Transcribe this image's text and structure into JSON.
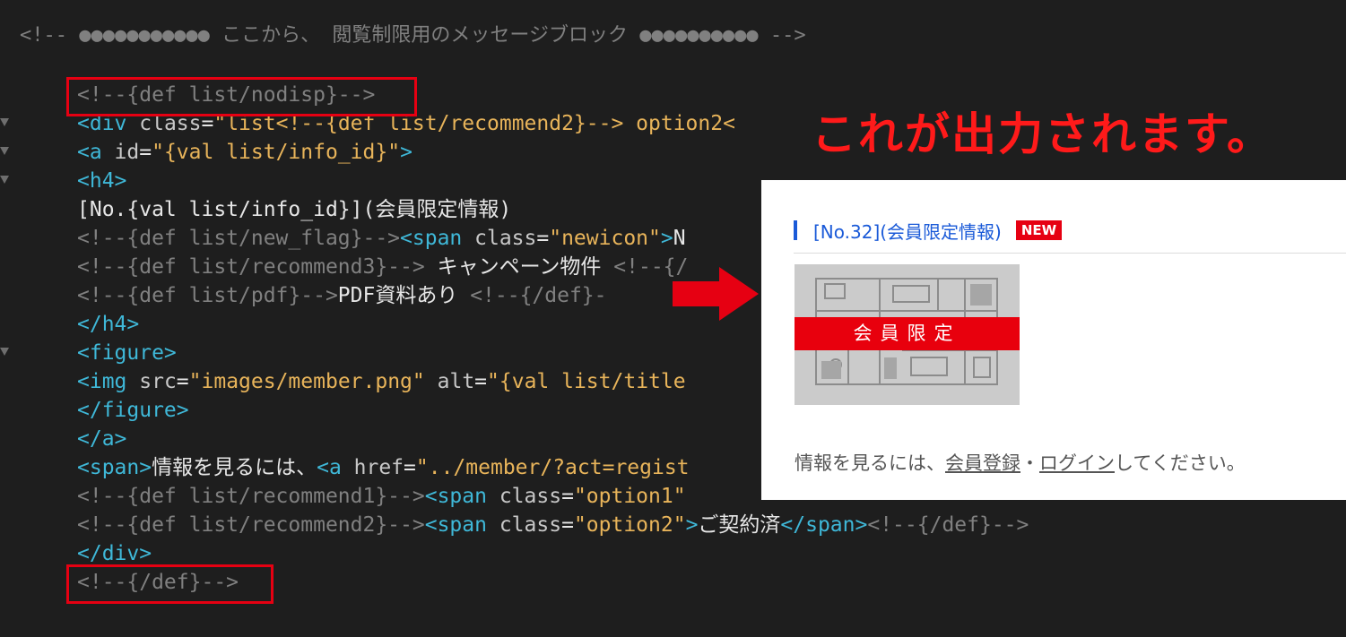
{
  "code_lines": [
    {
      "fold": false,
      "header": true,
      "tokens": [
        {
          "c": "c",
          "t": "<!-- ●●●●●●●●●●● ここから、 閲覧制限用のメッセージブロック ●●●●●●●●●● -->"
        }
      ]
    },
    {
      "fold": false,
      "tokens": [
        {
          "c": "c",
          "t": "<!--{def list/nodisp}-->"
        }
      ]
    },
    {
      "fold": true,
      "tokens": [
        {
          "c": "k",
          "t": "<div "
        },
        {
          "c": "a",
          "t": "class"
        },
        {
          "c": "w",
          "t": "="
        },
        {
          "c": "s",
          "t": "\"list<!--{def list/recommend2}--> option2<"
        }
      ]
    },
    {
      "fold": true,
      "tokens": [
        {
          "c": "k",
          "t": "<a "
        },
        {
          "c": "a",
          "t": "id"
        },
        {
          "c": "w",
          "t": "="
        },
        {
          "c": "s",
          "t": "\"{val list/info_id}\""
        },
        {
          "c": "k",
          "t": ">"
        }
      ]
    },
    {
      "fold": true,
      "tokens": [
        {
          "c": "k",
          "t": "<h4>"
        }
      ]
    },
    {
      "fold": false,
      "tokens": [
        {
          "c": "w",
          "t": "[No.{val list/info_id}](会員限定情報)"
        }
      ]
    },
    {
      "fold": false,
      "tokens": [
        {
          "c": "c",
          "t": "<!--{def list/new_flag}-->"
        },
        {
          "c": "k",
          "t": "<span "
        },
        {
          "c": "a",
          "t": "class"
        },
        {
          "c": "w",
          "t": "="
        },
        {
          "c": "s",
          "t": "\"newicon\""
        },
        {
          "c": "k",
          "t": ">"
        },
        {
          "c": "w",
          "t": "N"
        }
      ]
    },
    {
      "fold": false,
      "tokens": [
        {
          "c": "c",
          "t": "<!--{def list/recommend3}--> "
        },
        {
          "c": "w",
          "t": "キャンペーン物件 "
        },
        {
          "c": "c",
          "t": "<!--{/"
        }
      ]
    },
    {
      "fold": false,
      "tokens": [
        {
          "c": "c",
          "t": "<!--{def list/pdf}-->"
        },
        {
          "c": "w",
          "t": "PDF資料あり "
        },
        {
          "c": "c",
          "t": "<!--{/def}-"
        }
      ]
    },
    {
      "fold": false,
      "tokens": [
        {
          "c": "k",
          "t": "</h4>"
        }
      ]
    },
    {
      "fold": true,
      "tokens": [
        {
          "c": "k",
          "t": "<figure>"
        }
      ]
    },
    {
      "fold": false,
      "tokens": [
        {
          "c": "k",
          "t": "<img "
        },
        {
          "c": "a",
          "t": "src"
        },
        {
          "c": "w",
          "t": "="
        },
        {
          "c": "s",
          "t": "\"images/member.png\""
        },
        {
          "c": "w",
          "t": " "
        },
        {
          "c": "a",
          "t": "alt"
        },
        {
          "c": "w",
          "t": "="
        },
        {
          "c": "s",
          "t": "\"{val list/title"
        }
      ]
    },
    {
      "fold": false,
      "tokens": [
        {
          "c": "k",
          "t": "</figure>"
        }
      ]
    },
    {
      "fold": false,
      "tokens": [
        {
          "c": "k",
          "t": "</a>"
        }
      ]
    },
    {
      "fold": false,
      "tokens": [
        {
          "c": "k",
          "t": "<span>"
        },
        {
          "c": "w",
          "t": "情報を見るには、"
        },
        {
          "c": "k",
          "t": "<a "
        },
        {
          "c": "a",
          "t": "href"
        },
        {
          "c": "w",
          "t": "="
        },
        {
          "c": "s",
          "t": "\"../member/?act=regist"
        }
      ]
    },
    {
      "fold": false,
      "tokens": [
        {
          "c": "c",
          "t": "<!--{def list/recommend1}-->"
        },
        {
          "c": "k",
          "t": "<span "
        },
        {
          "c": "a",
          "t": "class"
        },
        {
          "c": "w",
          "t": "="
        },
        {
          "c": "s",
          "t": "\"option1\""
        }
      ]
    },
    {
      "fold": false,
      "tokens": [
        {
          "c": "c",
          "t": "<!--{def list/recommend2}-->"
        },
        {
          "c": "k",
          "t": "<span "
        },
        {
          "c": "a",
          "t": "class"
        },
        {
          "c": "w",
          "t": "="
        },
        {
          "c": "s",
          "t": "\"option2\""
        },
        {
          "c": "k",
          "t": ">"
        },
        {
          "c": "w",
          "t": "ご契約済"
        },
        {
          "c": "k",
          "t": "</span>"
        },
        {
          "c": "c",
          "t": "<!--{/def}-->"
        }
      ]
    },
    {
      "fold": false,
      "tokens": [
        {
          "c": "k",
          "t": "</div>"
        }
      ]
    },
    {
      "fold": false,
      "tokens": [
        {
          "c": "c",
          "t": "<!--{/def}-->"
        }
      ]
    }
  ],
  "callout": "これが出力されます。",
  "preview": {
    "heading": "[No.32](会員限定情報)",
    "new_badge": "NEW",
    "member_band": "会員限定",
    "footer_prefix": "情報を見るには、",
    "register_link": "会員登録",
    "separator": "・",
    "login_link": "ログイン",
    "footer_suffix": "してください。"
  },
  "colors": {
    "accent_red": "#e60012",
    "heading_blue": "#1a5ad8"
  }
}
